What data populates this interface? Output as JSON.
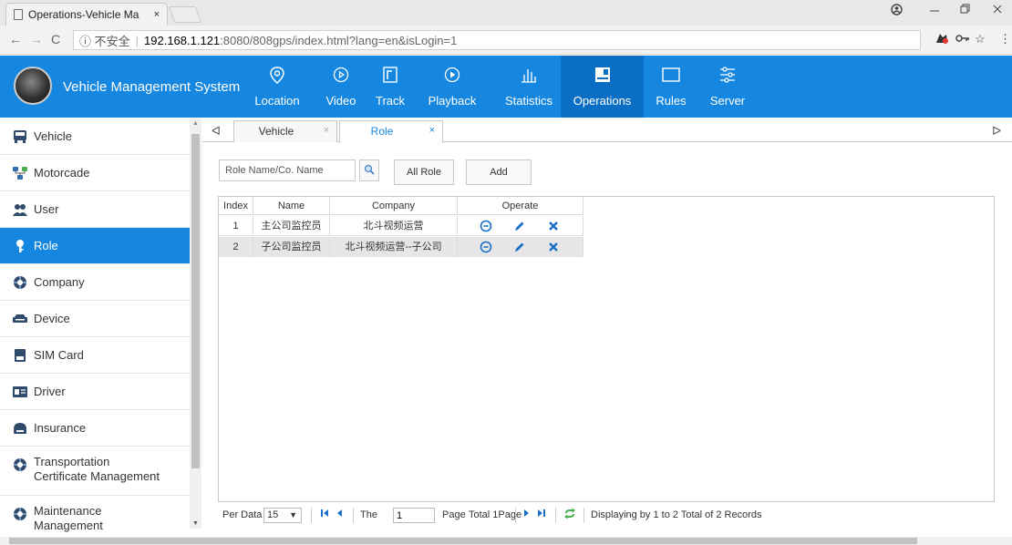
{
  "browser": {
    "tab_title": "Operations-Vehicle Ma",
    "tab_close": "×",
    "security_label": "ⓘ 不安全",
    "url_host": "192.168.1.121",
    "url_path": ":8080/808gps/index.html?lang=en&isLogin=1"
  },
  "app": {
    "title": "Vehicle Management System",
    "nav": [
      {
        "label": "Location",
        "icon": "location-pin-icon"
      },
      {
        "label": "Video",
        "icon": "play-circle-icon"
      },
      {
        "label": "Track",
        "icon": "track-icon"
      },
      {
        "label": "Playback",
        "icon": "playback-icon"
      },
      {
        "label": "Statistics",
        "icon": "bar-chart-icon"
      },
      {
        "label": "Operations",
        "icon": "operations-icon",
        "active": true
      },
      {
        "label": "Rules",
        "icon": "rules-icon"
      },
      {
        "label": "Server",
        "icon": "server-icon"
      }
    ]
  },
  "sidebar": {
    "items": [
      {
        "label": "Vehicle",
        "icon": "bus-icon"
      },
      {
        "label": "Motorcade",
        "icon": "motorcade-icon"
      },
      {
        "label": "User",
        "icon": "users-icon"
      },
      {
        "label": "Role",
        "icon": "key-icon",
        "active": true
      },
      {
        "label": "Company",
        "icon": "company-icon"
      },
      {
        "label": "Device",
        "icon": "device-icon"
      },
      {
        "label": "SIM Card",
        "icon": "sim-card-icon"
      },
      {
        "label": "Driver",
        "icon": "driver-card-icon"
      },
      {
        "label": "Insurance",
        "icon": "insurance-icon"
      },
      {
        "label": "Transportation",
        "label2": "Certificate Management",
        "icon": "certificate-icon"
      },
      {
        "label": "Maintenance",
        "label2": "Management",
        "icon": "maintenance-icon"
      }
    ]
  },
  "content_tabs": [
    {
      "label": "Vehicle",
      "close": "×"
    },
    {
      "label": "Role",
      "close": "×",
      "active": true
    }
  ],
  "toolbar": {
    "search_placeholder": "Role Name/Co. Name",
    "all_role_label": "All Role",
    "add_label": "Add"
  },
  "grid": {
    "columns": [
      "Index",
      "Name",
      "Company",
      "Operate"
    ],
    "rows": [
      {
        "index": "1",
        "name": "主公司监控员",
        "company": "北斗视频运营"
      },
      {
        "index": "2",
        "name": "子公司监控员",
        "company": "北斗视频运营--子公司"
      }
    ]
  },
  "pager": {
    "per_data_label": "Per Data",
    "per_data_value": "15",
    "the_label": "The",
    "page_value": "1",
    "page_label": "Page",
    "total_pages": "Total 1Page",
    "status": "Displaying by 1 to 2 Total of 2 Records"
  },
  "colors": {
    "brand": "#1687e0",
    "brand_active": "#0a6fc4",
    "action_icon": "#1a6fc8"
  }
}
